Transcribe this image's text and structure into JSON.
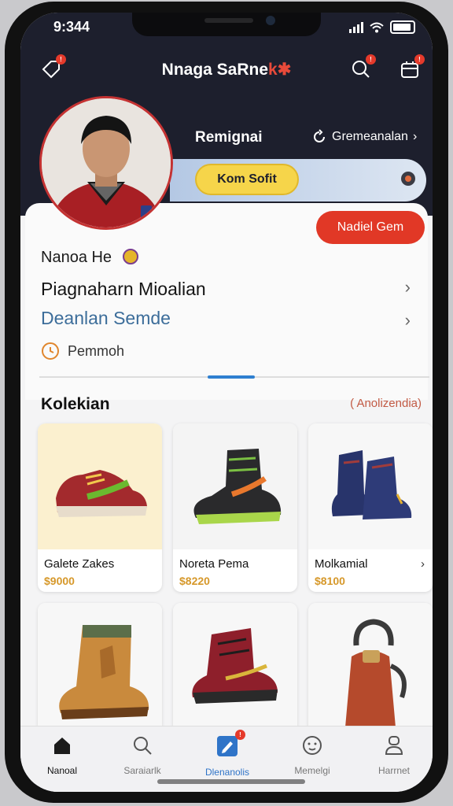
{
  "status": {
    "time": "9:344"
  },
  "header": {
    "app_name_main": "Nnaga SaRne",
    "app_name_accent": "k"
  },
  "profile": {
    "name": "Remignai",
    "link_label": "Gremeanalan",
    "badge_label": "Kom Sofit",
    "action_button": "Nadiel Gem"
  },
  "details": {
    "line1": "Nanoa He",
    "line2": "Piagnaharn Mioalian",
    "line3": "Deanlan Semde",
    "line4": "Pemmoh"
  },
  "collection": {
    "title": "Kolekian",
    "see_all": "( Anolizendia)",
    "items": [
      {
        "name": "Galete Zakes",
        "price": "$9000"
      },
      {
        "name": "Noreta Pema",
        "price": "$8220"
      },
      {
        "name": "Molkamial",
        "price": "$8100"
      },
      {
        "name": "",
        "price": ""
      },
      {
        "name": "",
        "price": ""
      },
      {
        "name": "",
        "price": ""
      }
    ]
  },
  "tabs": [
    {
      "label": "Nanoal",
      "icon": "home-icon"
    },
    {
      "label": "Saraiarlk",
      "icon": "search-icon"
    },
    {
      "label": "Dlenanolis",
      "icon": "edit-icon"
    },
    {
      "label": "Memelgi",
      "icon": "smile-icon"
    },
    {
      "label": "Harrnet",
      "icon": "profile-icon"
    }
  ],
  "colors": {
    "header_bg": "#1d1f2d",
    "accent_red": "#e13826",
    "accent_blue": "#2e7fd0",
    "price_gold": "#d6982a",
    "link_blue": "#3c6d9a"
  }
}
